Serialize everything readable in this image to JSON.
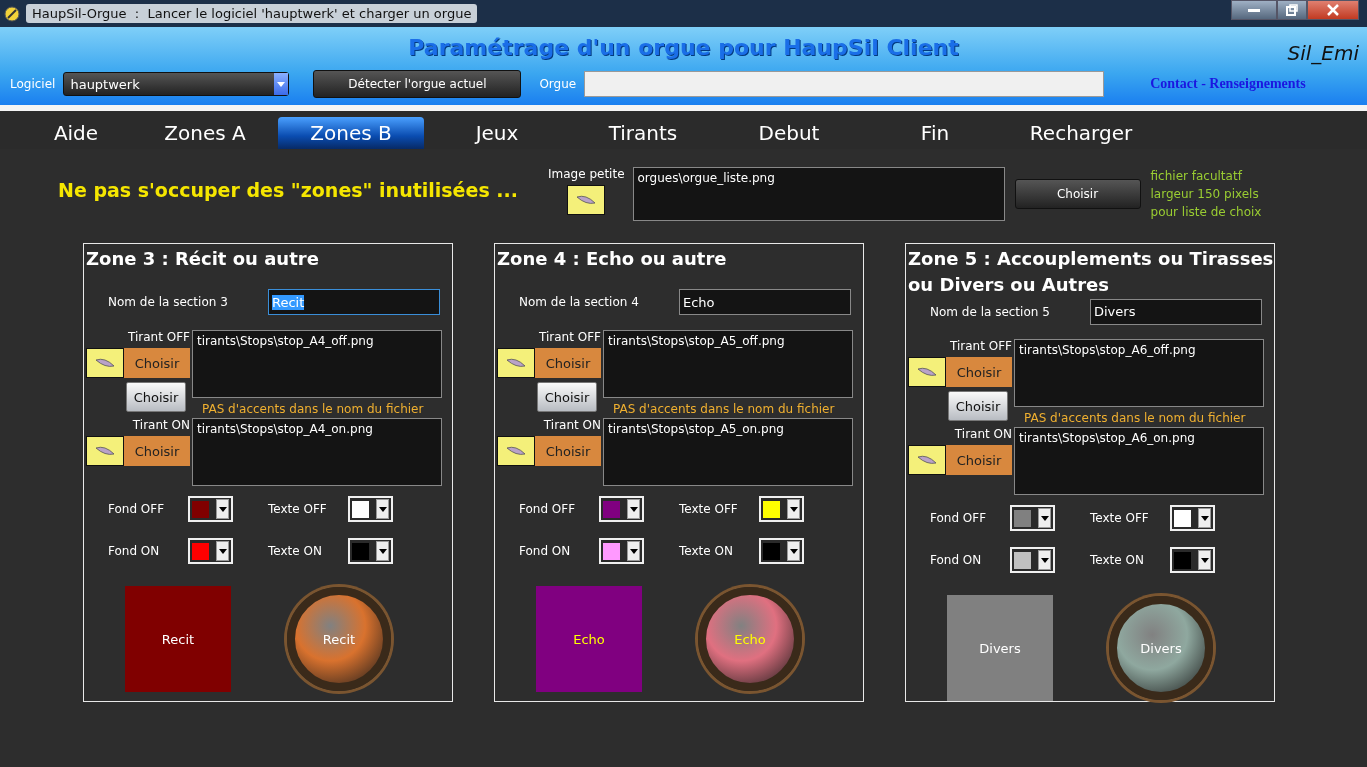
{
  "window": {
    "title": "HaupSil-Orgue  :  Lancer le logiciel 'hauptwerk' et charger un orgue"
  },
  "header": {
    "title": "Paramétrage d'un orgue pour HaupSil Client",
    "user": "Sil_Emi",
    "software_label": "Logiciel",
    "software_value": "hauptwerk",
    "detect_button": "Détecter l'orgue actuel",
    "organ_label": "Orgue",
    "contact_link": "Contact - Renseignements"
  },
  "tabs": [
    {
      "label": "Aide",
      "selected": false
    },
    {
      "label": "Zones A",
      "selected": false
    },
    {
      "label": "Zones B",
      "selected": true
    },
    {
      "label": "Jeux",
      "selected": false
    },
    {
      "label": "Tirants",
      "selected": false
    },
    {
      "label": "Debut",
      "selected": false
    },
    {
      "label": "Fin",
      "selected": false
    },
    {
      "label": "Recharger",
      "selected": false
    }
  ],
  "notice": "Ne pas s'occuper des \"zones\" inutilisées ...",
  "small_image": {
    "label": "Image petite",
    "path": "orgues\\orgue_liste.png",
    "button": "Choisir",
    "hints": [
      "fichier facultatf",
      "largeur 150 pixels",
      "pour liste de choix"
    ]
  },
  "zones": [
    {
      "title": "Zone 3 : Récit ou autre",
      "name_label": "Nom de la section 3",
      "name_value": "Recit",
      "text_selected": true,
      "off_label": "Tirant OFF",
      "off_path": "tirants\\Stops\\stop_A4_off.png",
      "off_button": "Choisir",
      "grey_button": "Choisir",
      "warning": "PAS d'accents dans le nom du fichier",
      "on_label": "Tirant ON",
      "on_path": "tirants\\Stops\\stop_A4_on.png",
      "on_button": "Choisir",
      "colors": [
        {
          "label": "Fond OFF",
          "color": "#800000"
        },
        {
          "label": "Texte OFF",
          "color": "#ffffff"
        },
        {
          "label": "Fond ON",
          "color": "#ff0000"
        },
        {
          "label": "Texte ON",
          "color": "#000000"
        }
      ],
      "square_text": "Recit",
      "round_text": "Recit",
      "color": "#d9722e"
    },
    {
      "title": "Zone 4 : Echo ou autre",
      "name_label": "Nom de la section 4",
      "name_value": "Echo",
      "text_selected": false,
      "off_label": "Tirant OFF",
      "off_path": "tirants\\Stops\\stop_A5_off.png",
      "off_button": "Choisir",
      "grey_button": "Choisir",
      "warning": "PAS d'accents dans le nom du fichier",
      "on_label": "Tirant ON",
      "on_path": "tirants\\Stops\\stop_A5_on.png",
      "on_button": "Choisir",
      "colors": [
        {
          "label": "Fond OFF",
          "color": "#800080"
        },
        {
          "label": "Texte OFF",
          "color": "#ffff00"
        },
        {
          "label": "Fond ON",
          "color": "#ff99ff"
        },
        {
          "label": "Texte ON",
          "color": "#000000"
        }
      ],
      "square_text": "Echo",
      "round_text": "Echo",
      "color": "#e07080"
    },
    {
      "title": "Zone 5 : Accouplements ou Tirasses ou Divers ou Autres",
      "name_label": "Nom de la section 5",
      "name_value": "Divers",
      "text_selected": false,
      "off_label": "Tirant OFF",
      "off_path": "tirants\\Stops\\stop_A6_off.png",
      "off_button": "Choisir",
      "grey_button": "Choisir",
      "warning": "PAS d'accents dans le nom du fichier",
      "on_label": "Tirant ON",
      "on_path": "tirants\\Stops\\stop_A6_on.png",
      "on_button": "Choisir",
      "colors": [
        {
          "label": "Fond OFF",
          "color": "#808080"
        },
        {
          "label": "Texte OFF",
          "color": "#ffffff"
        },
        {
          "label": "Fond ON",
          "color": "#c0c0c0"
        },
        {
          "label": "Texte ON",
          "color": "#000000"
        }
      ],
      "square_text": "Divers",
      "round_text": "Divers",
      "color": "#8fa89f"
    }
  ]
}
